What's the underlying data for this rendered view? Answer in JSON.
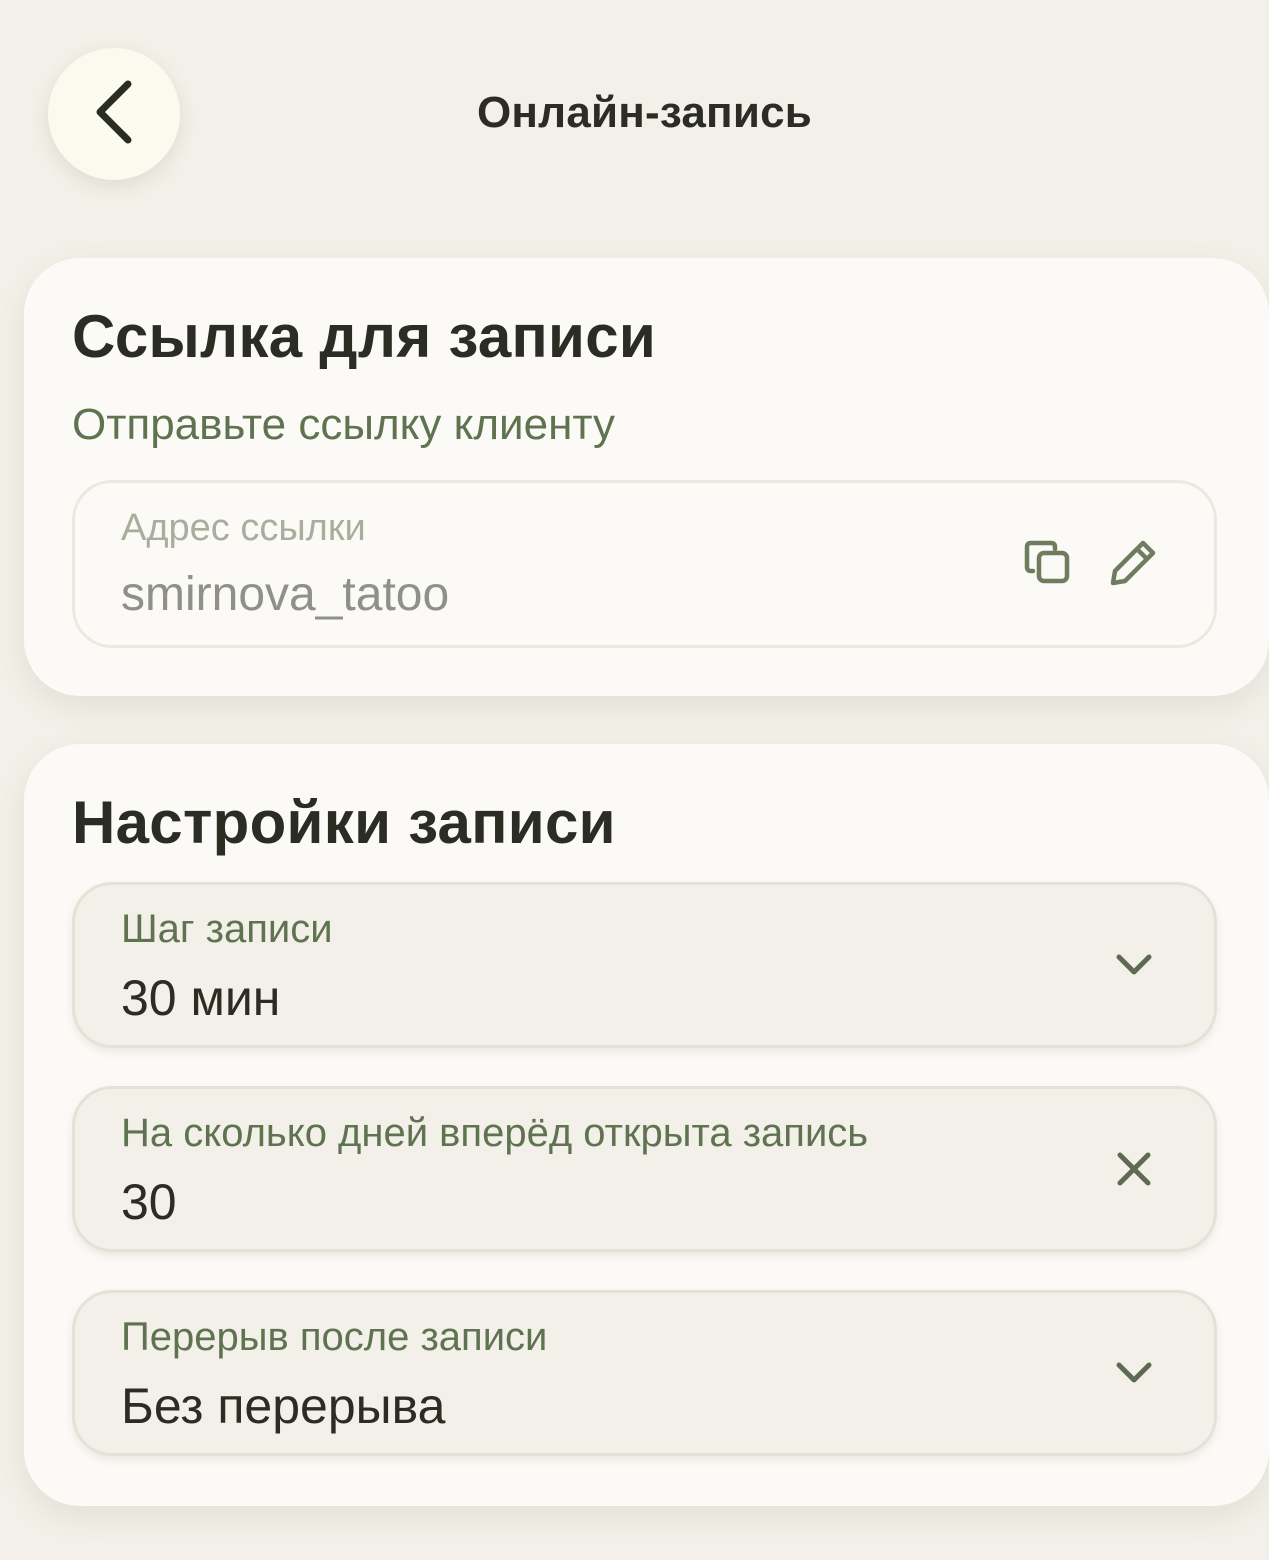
{
  "header": {
    "title": "Онлайн-запись",
    "back_icon": "chevron-left-icon"
  },
  "link_card": {
    "title": "Ссылка для записи",
    "subtitle": "Отправьте ссылку клиенту",
    "field": {
      "label": "Адрес ссылки",
      "value": "smirnova_tatoo",
      "copy_icon": "copy-icon",
      "edit_icon": "pencil-icon"
    }
  },
  "settings_card": {
    "title": "Настройки записи",
    "fields": [
      {
        "label": "Шаг записи",
        "value": "30 мин",
        "trailing_icon": "chevron-down-icon"
      },
      {
        "label": "На сколько дней вперёд открыта запись",
        "value": "30",
        "trailing_icon": "close-icon"
      },
      {
        "label": "Перерыв после записи",
        "value": "Без перерыва",
        "trailing_icon": "chevron-down-icon"
      }
    ]
  },
  "colors": {
    "background": "#f2f0e8",
    "card": "#fbfaf6",
    "text_primary": "#2b2d24",
    "text_accent": "#5f7350",
    "text_muted": "#a9ae9c"
  }
}
